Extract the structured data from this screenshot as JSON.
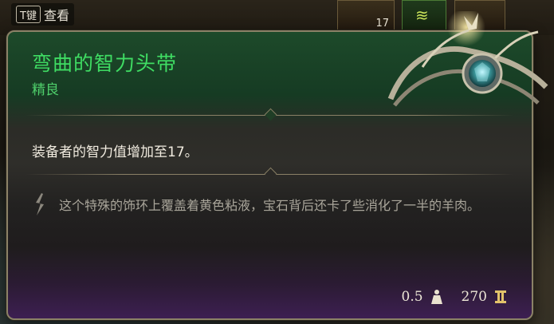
{
  "hud": {
    "hint_key": "T键",
    "hint_label": "查看",
    "item_count": "17"
  },
  "tooltip": {
    "name": "弯曲的智力头带",
    "rarity": "精良",
    "effect": "装备者的智力值增加至17。",
    "flavor": "这个特殊的饰环上覆盖着黄色粘液，宝石背后还卡了些消化了一半的羊肉。",
    "weight": "0.5",
    "value": "270",
    "name_color": "#3fdc63",
    "rarity_color": "#4fcf6b"
  },
  "icons": {
    "flavor": "quill-icon",
    "weight": "weight-icon",
    "value": "coin-icon",
    "artwork": "circlet-artwork"
  }
}
